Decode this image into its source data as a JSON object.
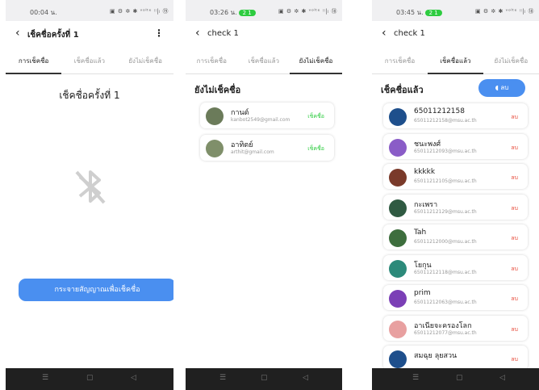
{
  "p1": {
    "time": "00:04 น.",
    "status_icons": "▣ ⚙ ✲ ✱ ᵛᵒˡᵗᵉ ᵎᵎ|ₗ ⑲",
    "title": "เช็คชื่อครั้งที่ 1",
    "tabs": [
      "การเช็คชื่อ",
      "เช็คชื่อแล้ว",
      "ยังไม่เช็คชื่อ"
    ],
    "heading": "เช็คชื่อครั้งที่ 1",
    "button": "กระจายสัญญาณเพื่อเช็คชื่อ"
  },
  "p2": {
    "time": "03:26 น.",
    "pill": "2 1",
    "status_icons": "▣ ⚙ ✲ ✱ ᵛᵒˡᵗᵉ ᵎᵎ|ₗ ⑱",
    "title": "check 1",
    "tabs": [
      "การเช็คชื่อ",
      "เช็คชื่อแล้ว",
      "ยังไม่เช็คชื่อ"
    ],
    "section": "ยังไม่เช็คชื่อ",
    "action": "เช็คชื่อ",
    "people": [
      {
        "name": "กานต์",
        "email": "kanbot2549@gmail.com"
      },
      {
        "name": "อาทิตย์",
        "email": "arthit@gmail.com"
      }
    ]
  },
  "p3": {
    "time": "03:45 น.",
    "pill": "2 1",
    "status_icons": "▣ ⚙ ✲ ✱ ᵛᵒˡᵗᵉ ᵎᵎ|ₗ ⑱",
    "title": "check 1",
    "tabs": [
      "การเช็คชื่อ",
      "เช็คชื่อแล้ว",
      "ยังไม่เช็คชื่อ"
    ],
    "section": "เช็คชื่อแล้ว",
    "group_button": "ลบ",
    "action": "ลบ",
    "people": [
      {
        "name": "65011212158",
        "email": "65011212158@msu.ac.th"
      },
      {
        "name": "ชนะพงศ์",
        "email": "65011212093@msu.ac.th"
      },
      {
        "name": "kkkkk",
        "email": "65011212105@msu.ac.th"
      },
      {
        "name": "กะเพรา",
        "email": "65011212129@msu.ac.th"
      },
      {
        "name": "Tah",
        "email": "65011212000@msu.ac.th"
      },
      {
        "name": "โยกุน",
        "email": "65011212118@msu.ac.th"
      },
      {
        "name": "prim",
        "email": "65011212063@msu.ac.th"
      },
      {
        "name": "อาเนียจะครองโลก",
        "email": "65011212077@msu.ac.th"
      },
      {
        "name": "สมฉุย ลุยสวน",
        "email": ""
      }
    ]
  },
  "nav": [
    "☰",
    "▢",
    "◁"
  ],
  "colors": {
    "accent": "#4a8ff0",
    "green": "#2ecc40",
    "red": "#e74c3c"
  }
}
